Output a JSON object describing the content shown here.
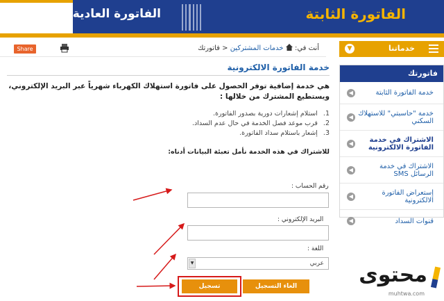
{
  "banner": {
    "title_fixed": "الفاتورة الثابتة",
    "title_regular": "الفاتورة العادية"
  },
  "toolbar": {
    "share_label": "Share"
  },
  "breadcrumb": {
    "prefix": "أنت في:",
    "item1": "خدمات المشتركين",
    "sep": "<",
    "item2": "فاتورتك"
  },
  "sidebar": {
    "header_label": "خدماتنا",
    "title": "فاتورتك",
    "items": [
      {
        "label": "خدمة الفاتورة الثابتة"
      },
      {
        "label": "خدمة \"حاسبتي\" للاستهلاك السكني"
      },
      {
        "label": "الاشتراك في خدمة الفاتورة الالكترونية"
      },
      {
        "label": "الاشتراك في خدمة الرسائل SMS"
      },
      {
        "label": "إستعراض الفاتورة الالكترونية"
      },
      {
        "label": "قنوات السداد"
      }
    ]
  },
  "content": {
    "title": "خدمة الفاتورة الالكترونية",
    "intro": "هي خدمة إضافية توفر الحصول على فاتورة استهلاك الكهرباء شهرياً عبر البريد الإلكتروني، ويستطيع المشترك من خلالها :",
    "features": [
      {
        "num": "1.",
        "text": "استلام إشعارات دورية بصدور الفاتورة."
      },
      {
        "num": "2.",
        "text": "قرب موعد فصل الخدمة في حال عدم السداد."
      },
      {
        "num": "3.",
        "text": "إشعار باستلام سداد الفاتورة."
      }
    ],
    "instructions": "للاشتراك في هذه الخدمة  نأمل تعبئة البيانات أدناه:"
  },
  "form": {
    "account_label": "رقم الحساب :",
    "account_value": "",
    "email_label": "البريد الإلكتروني :",
    "email_value": "",
    "language_label": "اللغة :",
    "language_value": "عربي",
    "cancel_label": "الغاء التسجيل",
    "submit_label": "تسجيل"
  },
  "logo": {
    "word": "محتوى",
    "url": "muhtwa.com"
  },
  "colors": {
    "navy": "#1f3f8f",
    "orange": "#e7a200",
    "button": "#e7900c",
    "annotation_red": "#d61a1a"
  }
}
